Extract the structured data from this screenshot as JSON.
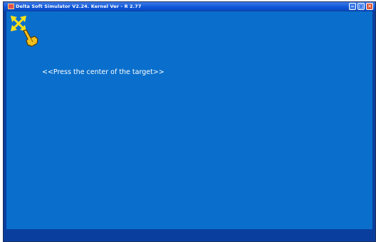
{
  "window": {
    "title": "Delta Soft Simulator V2.24. Kernel Ver - R 2.77",
    "controls": {
      "minimize_icon": "minimize-icon",
      "maximize_icon": "maximize-icon",
      "close_icon": "close-icon",
      "close_glyph": "✕"
    }
  },
  "calibration": {
    "prompt": "<<Press the center of the target>>",
    "target_icon": "target-crosshair-icon",
    "pointer_icon": "pointing-hand-icon"
  },
  "colors": {
    "background": "#0a6fcc",
    "frame": "#0a3e9e",
    "target": "#ffe11a",
    "hand": "#f2c01e"
  }
}
